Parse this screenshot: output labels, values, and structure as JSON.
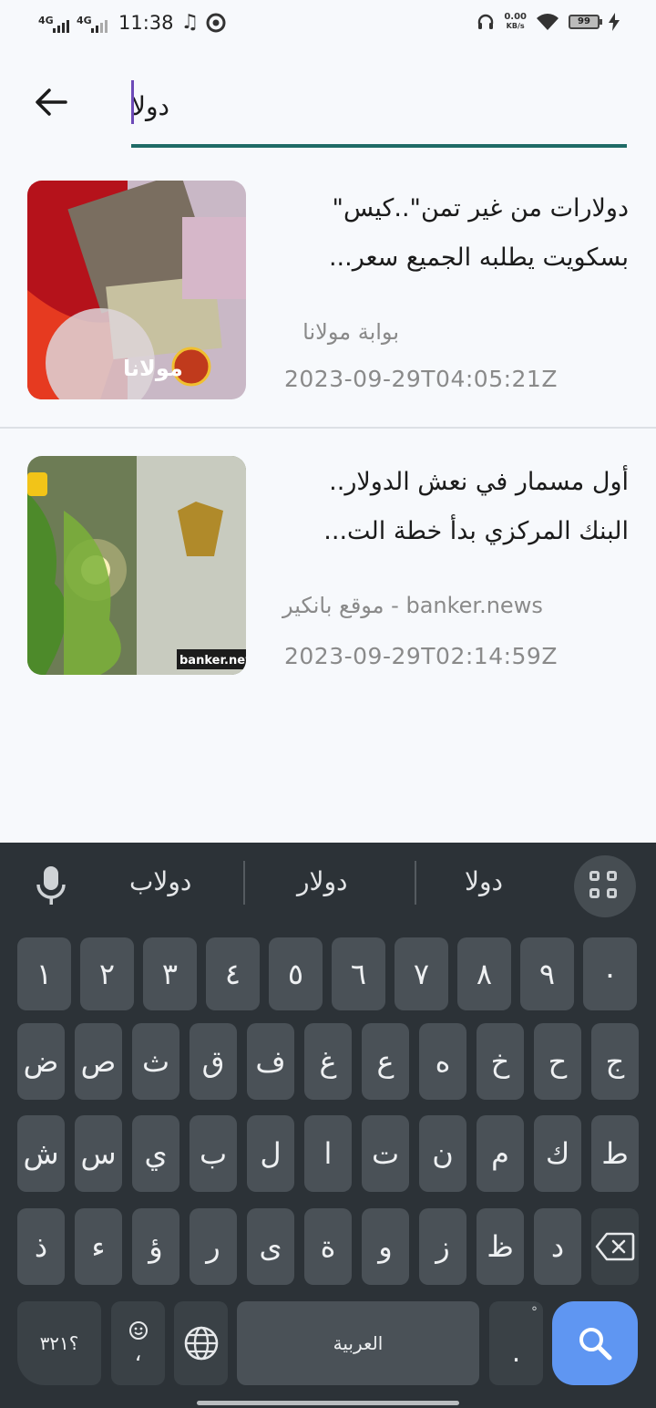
{
  "status_bar": {
    "signal1": "4G",
    "signal2": "4G",
    "time": "11:38",
    "net_speed_value": "0.00",
    "net_speed_unit": "KB/s",
    "battery": "99"
  },
  "search": {
    "query": "دولا"
  },
  "results": [
    {
      "title_line1": "دولارات من غير تمن\"..كيس\"",
      "title_line2": "بسكويت يطلبه الجميع سعر...",
      "source": "بوابة مولانا",
      "date": "2023-09-29T04:05:21Z",
      "thumb_watermark": "مولانا"
    },
    {
      "title_line1": "أول مسمار في نعش الدولار..",
      "title_line2": "البنك المركزي بدأ خطة الت...",
      "source": "banker.news - موقع بانكير",
      "date": "2023-09-29T02:14:59Z",
      "thumb_watermark": "banker.news"
    }
  ],
  "keyboard": {
    "suggestions": [
      "دولاب",
      "دولار",
      "دولا"
    ],
    "row_digits": [
      "١",
      "٢",
      "٣",
      "٤",
      "٥",
      "٦",
      "٧",
      "٨",
      "٩",
      "٠"
    ],
    "row1": [
      "ض",
      "ص",
      "ث",
      "ق",
      "ف",
      "غ",
      "ع",
      "ه",
      "خ",
      "ح",
      "ج"
    ],
    "row2": [
      "ش",
      "س",
      "ي",
      "ب",
      "ل",
      "ا",
      "ت",
      "ن",
      "م",
      "ك",
      "ط"
    ],
    "row3": [
      "ذ",
      "ء",
      "ؤ",
      "ر",
      "ى",
      "ة",
      "و",
      "ز",
      "ظ",
      "د"
    ],
    "symbols_key": "؟٣٢١",
    "emoji_comma": "،",
    "space_label": "العربية",
    "period": "."
  },
  "colors": {
    "accent": "#1f6b67",
    "caret": "#6d4ab8",
    "keyboard_bg": "#2c3237",
    "key_bg": "#4a5157",
    "search_key": "#5f96f2"
  }
}
